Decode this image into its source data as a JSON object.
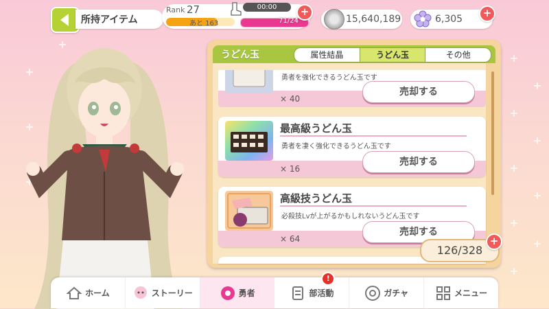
{
  "header": {
    "title": "所持アイテム",
    "rank_label": "Rank",
    "rank_value": "27",
    "exp_remaining": "あと 163",
    "exp_progress": 0.75,
    "stamina_timer": "00:00",
    "stamina": "71/24",
    "stamina_progress": 1.0,
    "money": "15,640,189",
    "gems": "6,305"
  },
  "category": {
    "label": "うどん玉",
    "filters": [
      "属性結晶",
      "うどん玉",
      "その他"
    ],
    "active_filter": "うどん玉"
  },
  "items": [
    {
      "name": "",
      "description": "勇者を強化できるうどん玉です",
      "quantity": "× 40",
      "sell_label": "売却する"
    },
    {
      "name": "最高級うどん玉",
      "description": "勇者を凄く強化できるうどん玉です",
      "quantity": "× 16",
      "sell_label": "売却する"
    },
    {
      "name": "高級技うどん玉",
      "description": "必殺技Lvが上がるかもしれないうどん玉です",
      "quantity": "× 64",
      "sell_label": "売却する"
    },
    {
      "name": "",
      "description": "",
      "quantity": "",
      "sell_label": ""
    }
  ],
  "item_count": "126/328",
  "nav": [
    {
      "label": "ホーム",
      "icon": "home-icon"
    },
    {
      "label": "ストーリー",
      "icon": "story-icon"
    },
    {
      "label": "勇者",
      "icon": "hero-icon"
    },
    {
      "label": "部活動",
      "icon": "club-icon",
      "badge": "!"
    },
    {
      "label": "ガチャ",
      "icon": "gacha-icon"
    },
    {
      "label": "メニュー",
      "icon": "menu-icon"
    }
  ],
  "colors": {
    "accent_green": "#a9c641",
    "accent_pink": "#e8388f",
    "exp_orange": "#f6a313"
  }
}
